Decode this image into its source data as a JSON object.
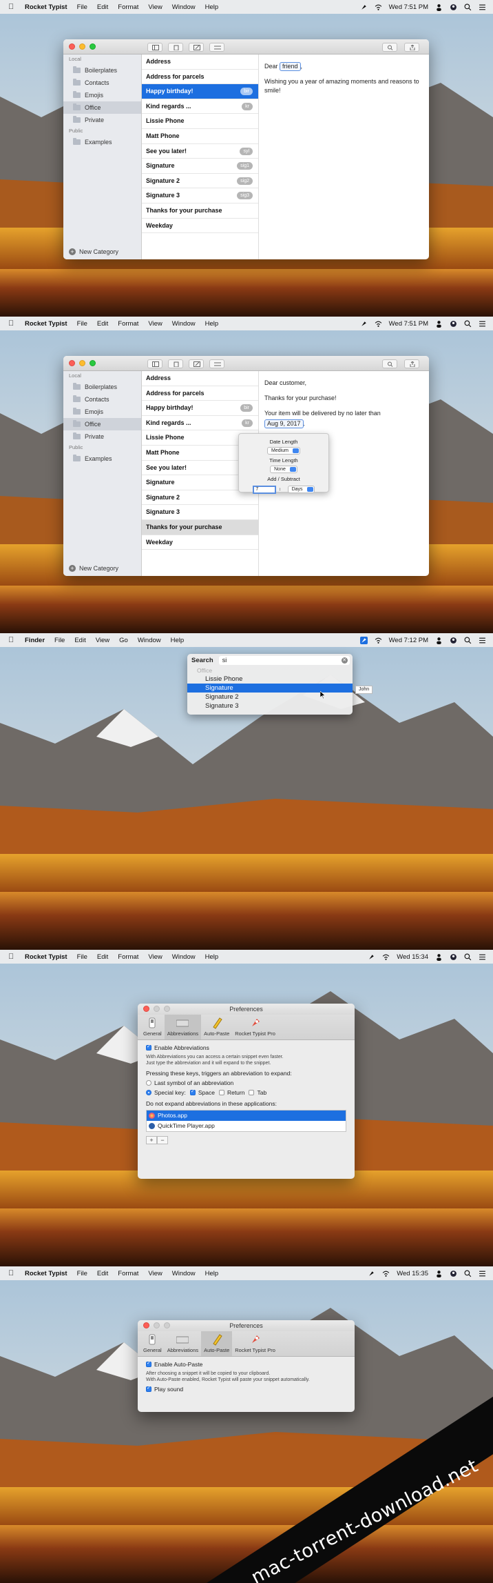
{
  "menubar_app": {
    "app": "Rocket Typist",
    "menus": [
      "File",
      "Edit",
      "Format",
      "View",
      "Window",
      "Help"
    ]
  },
  "menubar_finder": {
    "app": "Finder",
    "menus": [
      "File",
      "Edit",
      "View",
      "Go",
      "Window",
      "Help"
    ]
  },
  "clocks": {
    "s1": "Wed 7:51 PM",
    "s2": "Wed 7:51 PM",
    "s3": "Wed 7:12 PM",
    "s4": "Wed 15:34",
    "s5": "Wed 15:35"
  },
  "sidebar": {
    "local_header": "Local",
    "public_header": "Public",
    "local_items": [
      "Boilerplates",
      "Contacts",
      "Emojis",
      "Office",
      "Private"
    ],
    "public_items": [
      "Examples"
    ],
    "new_category": "New Category"
  },
  "list1": [
    {
      "name": "Address",
      "abbr": ""
    },
    {
      "name": "Address for parcels",
      "abbr": ""
    },
    {
      "name": "Happy birthday!",
      "abbr": "bir"
    },
    {
      "name": "Kind regards ...",
      "abbr": "kr"
    },
    {
      "name": "Lissie Phone",
      "abbr": ""
    },
    {
      "name": "Matt Phone",
      "abbr": ""
    },
    {
      "name": "See you later!",
      "abbr": "syl"
    },
    {
      "name": "Signature",
      "abbr": "sig1"
    },
    {
      "name": "Signature 2",
      "abbr": "sig2"
    },
    {
      "name": "Signature 3",
      "abbr": "sig3"
    },
    {
      "name": "Thanks for your purchase",
      "abbr": ""
    },
    {
      "name": "Weekday",
      "abbr": ""
    }
  ],
  "list2": [
    {
      "name": "Address",
      "abbr": ""
    },
    {
      "name": "Address for parcels",
      "abbr": ""
    },
    {
      "name": "Happy birthday!",
      "abbr": "bir"
    },
    {
      "name": "Kind regards ...",
      "abbr": "kr"
    },
    {
      "name": "Lissie Phone",
      "abbr": ""
    },
    {
      "name": "Matt Phone",
      "abbr": ""
    },
    {
      "name": "See you later!",
      "abbr": ""
    },
    {
      "name": "Signature",
      "abbr": ""
    },
    {
      "name": "Signature 2",
      "abbr": ""
    },
    {
      "name": "Signature 3",
      "abbr": ""
    },
    {
      "name": "Thanks for your purchase",
      "abbr": ""
    },
    {
      "name": "Weekday",
      "abbr": ""
    }
  ],
  "editor1": {
    "greeting": "Dear",
    "token": "friend",
    "comma": ",",
    "body": "Wishing you a year of amazing moments and reasons to smile!"
  },
  "editor2": {
    "greeting": "Dear customer,",
    "thanks": "Thanks for your purchase!",
    "deliver": "Your item will be delivered by no later than",
    "token": "Aug 9, 2017",
    "period": "."
  },
  "date_popover": {
    "date_length_label": "Date Length",
    "date_length_value": "Medium",
    "time_length_label": "Time Length",
    "time_length_value": "None",
    "add_sub_label": "Add / Subtract",
    "amount": "7",
    "unit": "Days"
  },
  "spotlight": {
    "label": "Search",
    "query": "si",
    "group": "Office",
    "items": [
      "Lissie Phone",
      "Signature",
      "Signature 2",
      "Signature 3"
    ],
    "tooltip": "John"
  },
  "prefs": {
    "title": "Preferences",
    "tabs": [
      "General",
      "Abbreviations",
      "Auto-Paste",
      "Rocket Typist Pro"
    ],
    "abbr": {
      "enable": "Enable Abbreviations",
      "desc1": "With Abbreviations you can access a certain snippet even faster.",
      "desc2": "Just type the abbreviation and it will expand to the snippet.",
      "keys_label": "Pressing these keys, triggers an abbreviation to expand:",
      "last_symbol": "Last symbol of an abbreviation",
      "special": "Special key:",
      "space": "Space",
      "return": "Return",
      "tab": "Tab",
      "noexpand": "Do not expand abbreviations in these applications:",
      "apps": [
        "Photos.app",
        "QuickTime Player.app"
      ],
      "plus": "+",
      "minus": "−"
    },
    "paste": {
      "enable": "Enable Auto-Paste",
      "desc1": "After choosing a snippet it will be copied to your clipboard.",
      "desc2": "With Auto-Paste enabled, Rocket Typist will paste your snippet automatically.",
      "sound": "Play sound"
    }
  },
  "watermark": "mac-torrent-download.net"
}
